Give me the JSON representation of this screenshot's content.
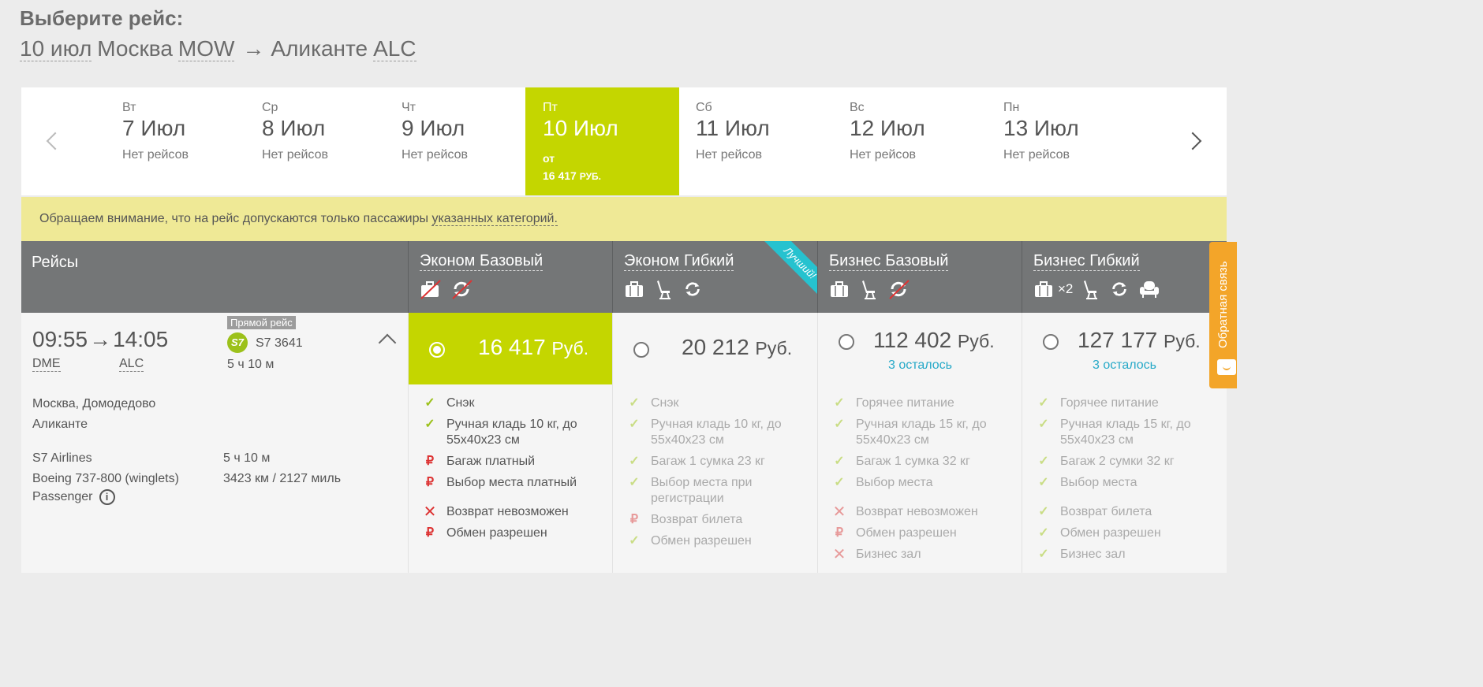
{
  "title": "Выберите рейс:",
  "route": {
    "date": "10 июл",
    "from_city": "Москва",
    "from_code": "MOW",
    "arrow": "→",
    "to_city": "Аликанте",
    "to_code": "ALC"
  },
  "dates": [
    {
      "dow": "Вт",
      "date": "7 Июл",
      "info": "Нет рейсов"
    },
    {
      "dow": "Ср",
      "date": "8 Июл",
      "info": "Нет рейсов"
    },
    {
      "dow": "Чт",
      "date": "9 Июл",
      "info": "Нет рейсов"
    },
    {
      "dow": "Пт",
      "date": "10 Июл",
      "from": "от",
      "price": "16 417",
      "currency": "РУБ."
    },
    {
      "dow": "Сб",
      "date": "11 Июл",
      "info": "Нет рейсов"
    },
    {
      "dow": "Вс",
      "date": "12 Июл",
      "info": "Нет рейсов"
    },
    {
      "dow": "Пн",
      "date": "13 Июл",
      "info": "Нет рейсов"
    }
  ],
  "notice": {
    "text": "Обращаем внимание, что на рейс допускаются только пассажиры ",
    "link": "указанных категорий."
  },
  "header": {
    "flights": "Рейсы",
    "best": "Лучший!",
    "x2": "×2"
  },
  "flight": {
    "dep_time": "09:55",
    "arr_time": "14:05",
    "dep_airport": "DME",
    "arr_airport": "ALC",
    "direct": "Прямой рейс",
    "airline_logo": "S7",
    "number": "S7 3641",
    "duration": "5 ч 10 м",
    "from_name": "Москва, Домодедово",
    "to_name": "Аликанте",
    "airline": "S7 Airlines",
    "duration2": "5 ч 10 м",
    "aircraft": "Boeing 737-800 (winglets)",
    "distance": "3423 км / 2127 миль",
    "cabin": "Passenger"
  },
  "fares": [
    {
      "name": "Эконом Базовый",
      "price": "16 417",
      "rub": "Руб.",
      "selected": true,
      "features": [
        {
          "mark": "check",
          "text": "Снэк"
        },
        {
          "mark": "check",
          "text": "Ручная кладь 10 кг, до 55x40x23 см"
        },
        {
          "mark": "rub",
          "text": "Багаж платный"
        },
        {
          "mark": "rub",
          "text": "Выбор места платный"
        },
        {
          "mark": "cross",
          "text": "Возврат невозможен",
          "gap": true
        },
        {
          "mark": "rub",
          "text": "Обмен разрешен"
        }
      ]
    },
    {
      "name": "Эконом Гибкий",
      "price": "20 212",
      "rub": "Руб.",
      "selected": false,
      "features": [
        {
          "mark": "check",
          "text": "Снэк"
        },
        {
          "mark": "check",
          "text": "Ручная кладь 10 кг, до 55x40x23 см"
        },
        {
          "mark": "check",
          "text": "Багаж 1 сумка 23 кг"
        },
        {
          "mark": "check",
          "text": "Выбор места при регистрации"
        },
        {
          "mark": "rub",
          "text": "Возврат билета"
        },
        {
          "mark": "check",
          "text": "Обмен разрешен"
        }
      ]
    },
    {
      "name": "Бизнес Базовый",
      "price": "112 402",
      "rub": "Руб.",
      "selected": false,
      "left": "3 осталось",
      "features": [
        {
          "mark": "check",
          "text": "Горячее питание"
        },
        {
          "mark": "check",
          "text": "Ручная кладь 15 кг, до 55x40x23 см"
        },
        {
          "mark": "check",
          "text": "Багаж 1 сумка 32 кг"
        },
        {
          "mark": "check",
          "text": "Выбор места"
        },
        {
          "mark": "cross",
          "text": "Возврат невозможен",
          "gap": true
        },
        {
          "mark": "rub",
          "text": "Обмен разрешен"
        },
        {
          "mark": "cross",
          "text": "Бизнес зал"
        }
      ]
    },
    {
      "name": "Бизнес Гибкий",
      "price": "127 177",
      "rub": "Руб.",
      "selected": false,
      "left": "3 осталось",
      "features": [
        {
          "mark": "check",
          "text": "Горячее питание"
        },
        {
          "mark": "check",
          "text": "Ручная кладь 15 кг, до 55x40x23 см"
        },
        {
          "mark": "check",
          "text": "Багаж 2 сумки 32 кг"
        },
        {
          "mark": "check",
          "text": "Выбор места"
        },
        {
          "mark": "check",
          "text": "Возврат билета",
          "gap": true
        },
        {
          "mark": "check",
          "text": "Обмен разрешен"
        },
        {
          "mark": "check",
          "text": "Бизнес зал"
        }
      ]
    }
  ],
  "feedback": "Обратная связь",
  "colors": {
    "accent": "#c4d600",
    "header": "#747677",
    "notice": "#efe996",
    "ribbon": "#26c2cf",
    "feedback": "#f3a529",
    "remaining": "#26a9c8",
    "paid": "#dd3333"
  }
}
